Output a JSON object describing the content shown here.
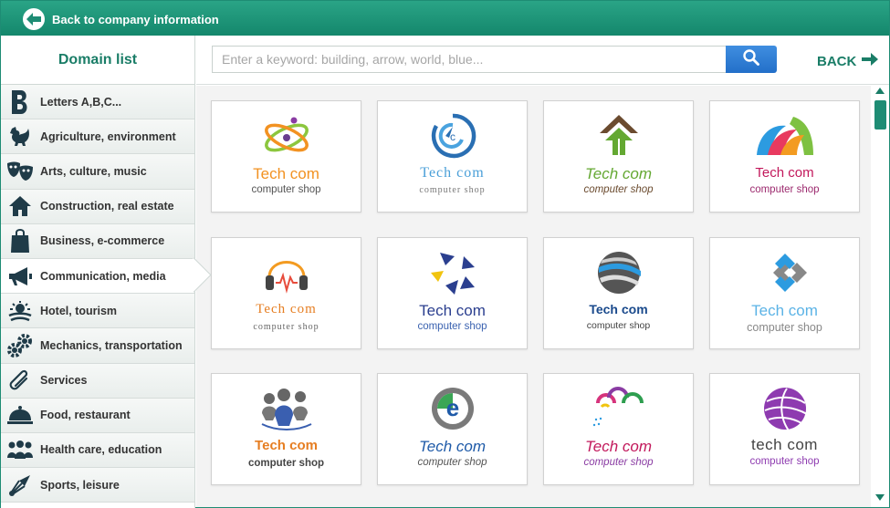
{
  "header": {
    "back_label": "Back to company information"
  },
  "sidebar": {
    "title": "Domain list",
    "items": [
      {
        "label": "Letters A,B,C...",
        "icon": "letter-b-icon"
      },
      {
        "label": "Agriculture, environment",
        "icon": "rooster-icon"
      },
      {
        "label": "Arts, culture, music",
        "icon": "theater-masks-icon"
      },
      {
        "label": "Construction, real estate",
        "icon": "house-icon"
      },
      {
        "label": "Business, e-commerce",
        "icon": "shopping-bag-icon"
      },
      {
        "label": "Communication, media",
        "icon": "megaphone-icon",
        "active": true
      },
      {
        "label": "Hotel, tourism",
        "icon": "beach-icon"
      },
      {
        "label": "Mechanics, transportation",
        "icon": "gears-icon"
      },
      {
        "label": "Services",
        "icon": "paperclip-icon"
      },
      {
        "label": "Food, restaurant",
        "icon": "cloche-icon"
      },
      {
        "label": "Health care, education",
        "icon": "people-icon"
      },
      {
        "label": "Sports, leisure",
        "icon": "shuttlecock-icon"
      }
    ]
  },
  "search": {
    "placeholder": "Enter a keyword: building, arrow, world, blue...",
    "value": ""
  },
  "back_button": {
    "label": "BACK"
  },
  "logos": [
    {
      "line1": "Tech com",
      "line2": "computer shop"
    },
    {
      "line1": "Tech com",
      "line2": "computer shop"
    },
    {
      "line1": "Tech com",
      "line2": "computer shop"
    },
    {
      "line1": "Tech com",
      "line2": "computer shop"
    },
    {
      "line1": "Tech com",
      "line2": "computer shop"
    },
    {
      "line1": "Tech com",
      "line2": "computer shop"
    },
    {
      "line1": "Tech com",
      "line2": "computer shop"
    },
    {
      "line1": "Tech com",
      "line2": "computer shop"
    },
    {
      "line1": "Tech com",
      "line2": "computer shop"
    },
    {
      "line1": "Tech com",
      "line2": "computer shop"
    },
    {
      "line1": "Tech com",
      "line2": "computer shop"
    },
    {
      "line1": "tech com",
      "line2": "computer shop"
    }
  ],
  "colors": {
    "primary": "#1e8c74",
    "search_button": "#2f7fd6"
  }
}
